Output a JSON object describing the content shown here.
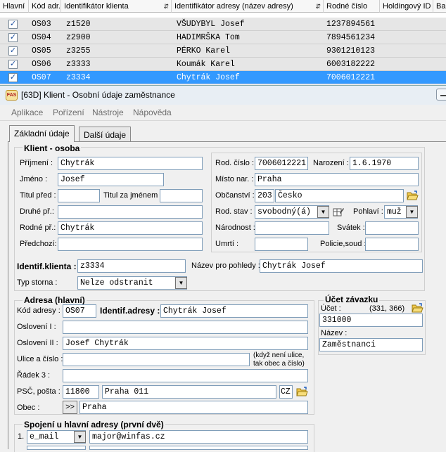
{
  "grid": {
    "headers": [
      "Hlavní",
      "Kód adr.",
      "Identifikátor klienta",
      "Identifikátor adresy (název adresy)",
      "Rodné číslo",
      "Holdingový ID",
      "Bar"
    ],
    "rows": [
      {
        "kod": "OS03",
        "ident": "z1520",
        "adresa": "VŠUDYBYL Josef",
        "rc": "1237894561"
      },
      {
        "kod": "OS04",
        "ident": "z2900",
        "adresa": "HADIMRŠKA Tom",
        "rc": "7894561234"
      },
      {
        "kod": "OS05",
        "ident": "z3255",
        "adresa": "PÉRKO Karel",
        "rc": "9301210123"
      },
      {
        "kod": "OS06",
        "ident": "z3333",
        "adresa": "Koumák Karel",
        "rc": "6003182222"
      },
      {
        "kod": "OS07",
        "ident": "z3334",
        "adresa": "Chytrák Josef",
        "rc": "7006012221"
      }
    ],
    "check": "✓"
  },
  "window": {
    "title": "[63D] Klient - Osobní údaje zaměstnance",
    "logo": "FAS"
  },
  "menu": [
    "Aplikace",
    "Pořízení",
    "Nástroje",
    "Nápověda"
  ],
  "tabs": [
    "Základní údaje",
    "Další údaje"
  ],
  "client": {
    "group_title": "Klient - osoba",
    "prijmeni_label": "Příjmení :",
    "prijmeni": "Chytrák",
    "jmeno_label": "Jméno :",
    "jmeno": "Josef",
    "titul_pred_label": "Titul před :",
    "titul_pred": "",
    "titul_za_label": "Titul za jménem :",
    "titul_za": "",
    "druhe_label": "Druhé př.:",
    "druhe": "",
    "rodne_pr_label": "Rodné př.:",
    "rodne_pr": "Chytrák",
    "predchozi_label": "Předchozí:",
    "predchozi": "",
    "rc_label": "Rod. číslo :",
    "rc": "7006012221",
    "narozeni_label": "Narození :",
    "narozeni": "1.6.1970",
    "misto_label": "Místo nar. :",
    "misto": "Praha",
    "obcanstvi_label": "Občanství :",
    "obcanstvi_kod": "203",
    "obcanstvi": "Česko",
    "stav_label": "Rod. stav :",
    "stav": "svobodný(á)",
    "pohlavi_label": "Pohlaví :",
    "pohlavi": "muž",
    "narodnost_label": "Národnost :",
    "narodnost": "",
    "svatek_label": "Svátek :",
    "svatek": "",
    "umrti_label": "Umrtí :",
    "umrti": "",
    "policie_label": "Policie,soud :",
    "policie": "",
    "identif_label": "Identif.klienta :",
    "identif": "z3334",
    "nazev_pohledy_label": "Název pro pohledy :",
    "nazev_pohledy": "Chytrák Josef",
    "typ_storna_label": "Typ storna :",
    "typ_storna": "Nelze odstranit"
  },
  "address": {
    "group_title": "Adresa (hlavní)",
    "kod_label": "Kód adresy :",
    "kod": "OS07",
    "identif_label": "Identif.adresy :",
    "identif": "Chytrák Josef",
    "osloveni1_label": "Oslovení I :",
    "osloveni1": "",
    "osloveni2_label": "Oslovení II :",
    "osloveni2": "Josef Chytrák",
    "ulice_label": "Ulice a číslo :",
    "ulice": "",
    "ulice_note1": "(když není ulice,",
    "ulice_note2": "tak obec a číslo)",
    "radek3_label": "Řádek 3 :",
    "radek3": "",
    "psc_label": "PSČ, pošta :",
    "psc": "11800",
    "posta": "Praha 011",
    "stat": "CZ",
    "obec_label": "Obec :",
    "obec_btn": ">>",
    "obec": "Praha"
  },
  "account": {
    "group_title": "Účet závazku",
    "ucet_label": "Účet :",
    "coords": "(331, 366)",
    "ucet": "331000",
    "nazev_label": "Název :",
    "nazev": "Zaměstnanci"
  },
  "contacts": {
    "group_title": "Spojení u hlavní adresy (první dvě)",
    "num1": "1.",
    "type1": "e_mail",
    "value1": "major@winfas.cz"
  }
}
